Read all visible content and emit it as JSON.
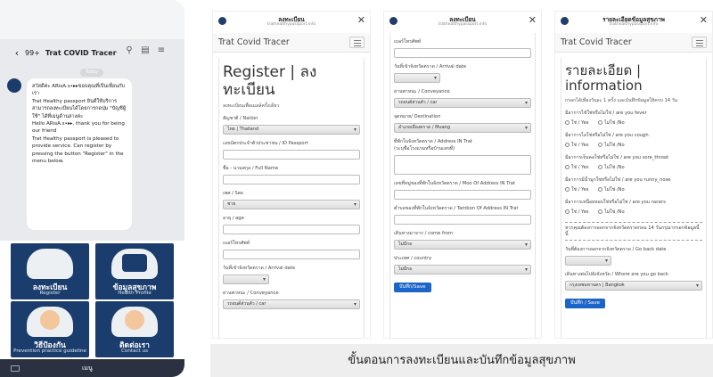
{
  "phone": {
    "back_count": "99+",
    "chat_title": "Trat COVID Tracer",
    "today": "Today",
    "message": [
      "สวัสดีค่ะ ARisA.s•▸▸ขอบคุณที่เป็นเพื่อนกับเรา",
      "Trat Healthy passport  ยินดีให้บริการ สามารถลงทะเบียนได้โดยการกดปุ่ม \"บัญชีผู้ใช้\" ได้ที่เมนูด้านล่างค่ะ",
      "Hello ARisA.s•▸▸, thank you for being our friend",
      "Trat Healthy passport is pleased to provide service. Can register by pressing the button \"Register\" in the menu below."
    ],
    "msg_time": "",
    "tiles": [
      {
        "th": "ลงทะเบียน",
        "en": "Register"
      },
      {
        "th": "ข้อมูลสุขภาพ",
        "en": "Health Profile"
      },
      {
        "th": "วิธีป้องกัน",
        "en": "Prevention practice guideline"
      },
      {
        "th": "ติดต่อเรา",
        "en": "Contact us"
      }
    ],
    "menu_label": "เมนู"
  },
  "panel1": {
    "window_title": "ลงทะเบียน",
    "url": "trathealthypassport.info",
    "brand": "Trat Covid Tracer",
    "heading": "Register | ลงทะเบียน",
    "subtitle": "ลงทะเบียนเพื่อเมลล์ครั้งเดียว",
    "f_nation": "สัญชาติ / Nation",
    "v_nation": "ไทย | Thailand",
    "f_id": "เลขบัตรประจำตัวประชาชน / ID Passport",
    "f_name": "ชื่อ - นามสกุล / Full Name",
    "f_sex": "เพศ / Sex",
    "v_sex": "ชาย",
    "f_age": "อายุ / age",
    "f_phone": "เบอร์โทรศัพท์",
    "f_arrival": "วันที่เข้าจังหวัดตราด / Arrival date",
    "f_conv": "ยานพาหนะ / Conveyance",
    "v_conv": "รถยนต์ส่วนตัว / car"
  },
  "panel2": {
    "window_title": "ลงทะเบียน",
    "url": "trathealthypassport.info",
    "f_phone": "เบอร์โทรศัพท์",
    "f_arrival": "วันที่เข้าจังหวัดตราด / Arrival date",
    "f_conv": "ยานพาหนะ / Conveyance",
    "v_conv": "รถยนต์ส่วนตัว / car",
    "f_dest": "จุดหมาย/ Destination",
    "v_dest": "อำเภอเมืองตราด / Muang",
    "f_addr": "ที่พักในจังหวัดตราด / Address IN Trat",
    "f_addr2": "(ระบุชื่อโรงแรมหรือบ้านเลขที่)",
    "f_moo": "เลขที่หมู่ของที่พักในจังหวัดตราด / Moo Of Address IN Trat",
    "f_tambon": "ตำบลของที่พักในจังหวัดตราด / Tambon Of Address IN Trat",
    "f_from": "เดินทางมาจาก / come from",
    "v_from": "ไม่มีกอ",
    "f_country": "ประเทศ / country",
    "v_country": "ไม่มีกอ",
    "save": "บันทึก/Save"
  },
  "panel3": {
    "window_title": "รายละเอียดข้อมูลสุขภาพ",
    "url": "trathealthypassport.info",
    "brand": "Trat Covid Tracer",
    "heading1": "รายละเอียด |",
    "heading2": "information",
    "subtitle": "กรอกได้เพียงวันละ 1 ครั้ง และบันทึกข้อมูลให้ครบ 14 วัน",
    "questions": [
      "มีอาการไข้ใช่หรือไม่ใช่ / are you fever",
      "มีอาการไอใช่หรือไม่ใช่ / are you cough",
      "มีอาการเจ็บคอใช่หรือไม่ใช่ / are you sore_throat",
      "มีอาการมีน้ำมูกใช่หรือไม่ใช่ / are you runny_nose",
      "มีอาการเหนื่อยหอบใช่หรือไม่ใช่ / are you racers"
    ],
    "yes": "ใช่ / Yes",
    "no": "ไม่ใช่ /No",
    "note": "หากคุณต้องการออกจากจังหวัดตราดก่อน 14 วันกรุณากรอกข้อมูลนี้นี้",
    "f_goback": "วันที่ต้องการออกจากจังหวัดตราด / Go back date",
    "f_where": "เดินทางต่อไปยังจังหวัด / Where are you go back",
    "v_where": "กรุงเทพมหานคร | Bangkok",
    "save": "บันทึก / Save"
  },
  "caption": "ขั้นตอนการลงทะเบียนและบันทึกข้อมูลสุขภาพ"
}
